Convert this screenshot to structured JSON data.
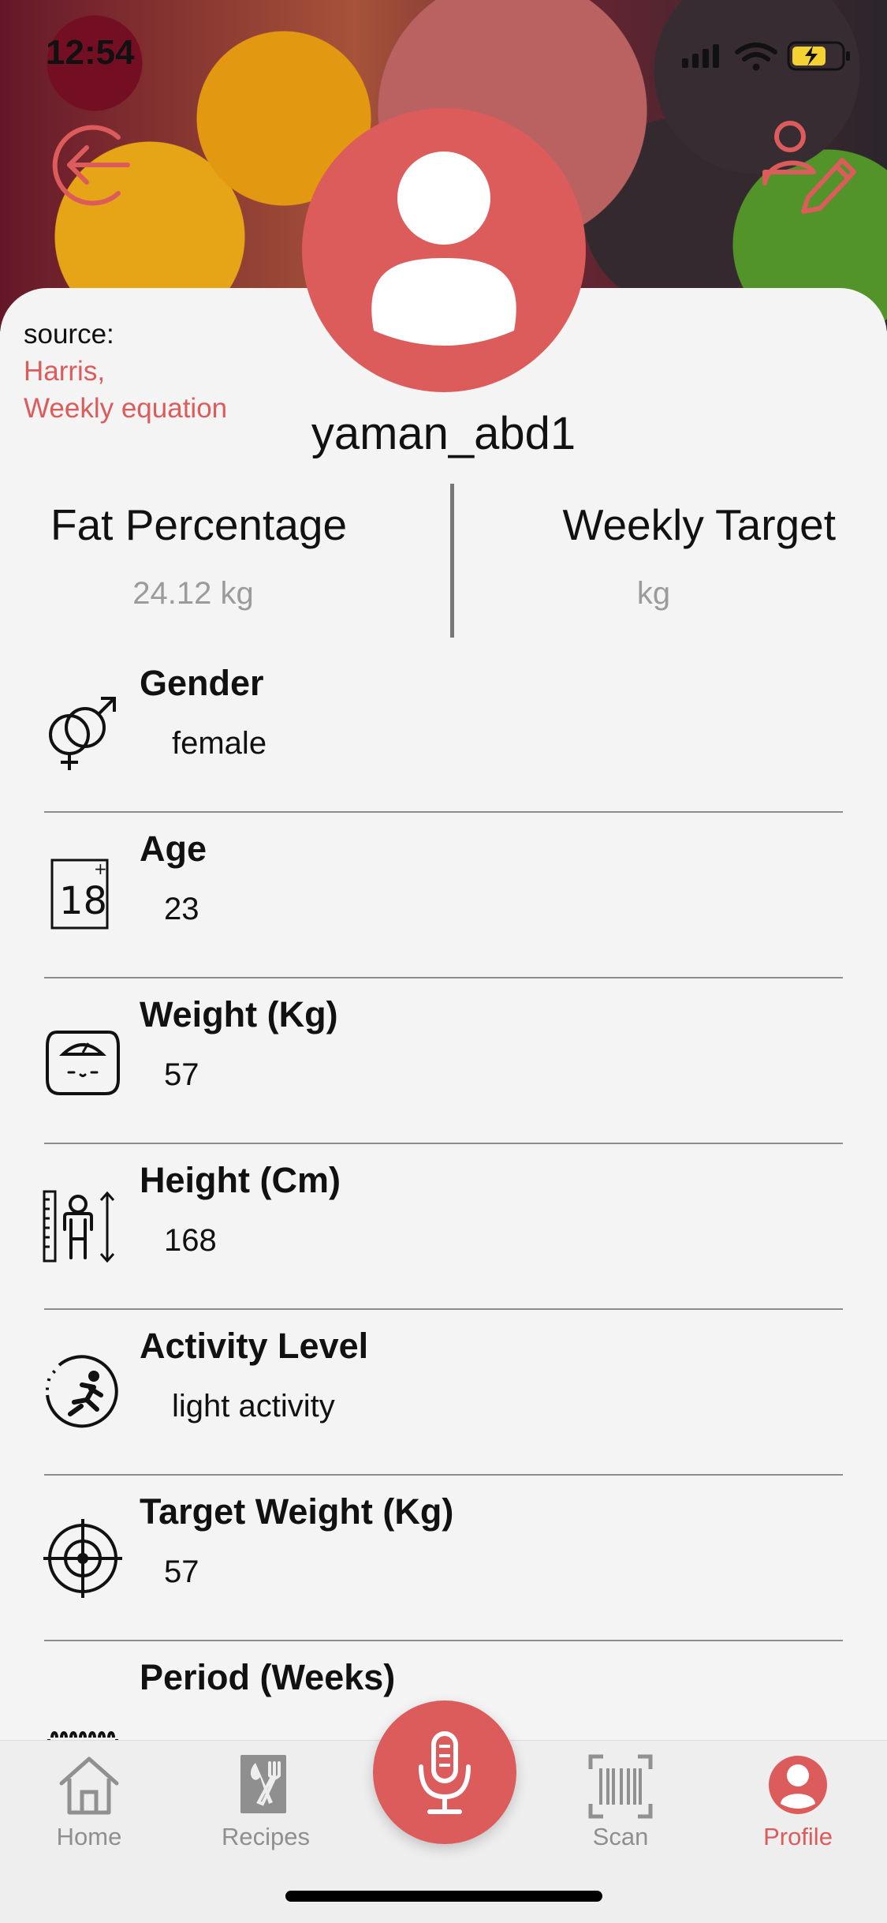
{
  "status_bar": {
    "time": "12:54"
  },
  "profile": {
    "source_label": "source:",
    "source_line1": "Harris,",
    "source_line2": "Weekly equation",
    "username": "yaman_abd1",
    "fat_percentage_title": "Fat Percentage",
    "fat_percentage_value": "24.12 kg",
    "weekly_target_title": "Weekly Target",
    "weekly_target_value": "kg"
  },
  "details": [
    {
      "label": "Gender",
      "value": "female",
      "icon": "gender-icon"
    },
    {
      "label": "Age",
      "value": "23",
      "icon": "age-18-icon"
    },
    {
      "label": "Weight (Kg)",
      "value": "57",
      "icon": "scale-icon"
    },
    {
      "label": "Height (Cm)",
      "value": "168",
      "icon": "height-icon"
    },
    {
      "label": "Activity Level",
      "value": "light activity",
      "icon": "running-icon"
    },
    {
      "label": "Target Weight (Kg)",
      "value": "57",
      "icon": "target-icon"
    },
    {
      "label": "Period (Weeks)",
      "value": "",
      "icon": "calendar-icon"
    }
  ],
  "nav": {
    "home": "Home",
    "recipes": "Recipes",
    "scan": "Scan",
    "profile": "Profile"
  },
  "colors": {
    "accent": "#dc5b5b",
    "text": "#111111",
    "muted": "#9b9b9b"
  }
}
